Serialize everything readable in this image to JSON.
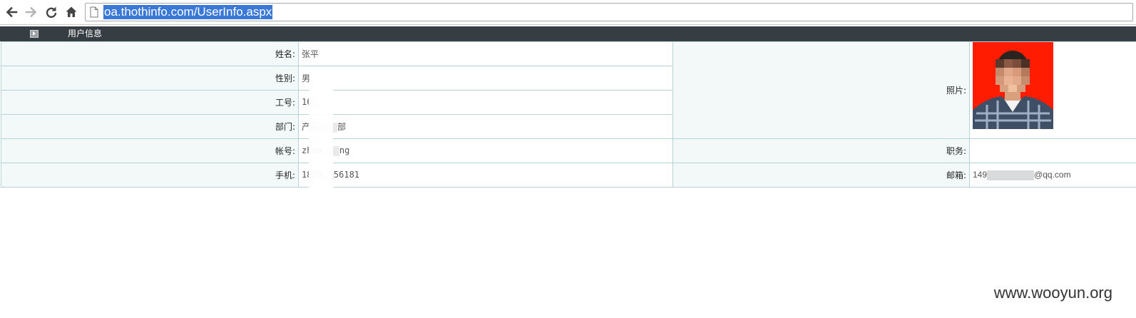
{
  "browser": {
    "url": "oa.thothinfo.com/UserInfo.aspx",
    "icons": [
      "back-icon",
      "forward-icon",
      "reload-icon",
      "home-icon",
      "page-icon"
    ]
  },
  "titlebar": {
    "title": "用户信息"
  },
  "fields": {
    "name": {
      "label": "姓名:",
      "value": "张平"
    },
    "gender": {
      "label": "性别:",
      "value": "男"
    },
    "emp_no": {
      "label": "工号:",
      "value": "16"
    },
    "dept": {
      "label": "部门:",
      "value_a": "产品",
      "value_b": "部"
    },
    "account": {
      "label": "帐号:",
      "value_a": "zhan",
      "value_b": "ng"
    },
    "mobile": {
      "label": "手机:",
      "value_a": "1826",
      "value_b": "56181"
    },
    "photo": {
      "label": "照片:"
    },
    "position": {
      "label": "职务:",
      "value": ""
    },
    "email": {
      "label": "邮箱:",
      "value_a": "149",
      "value_b": "@qq.com"
    }
  },
  "colors": {
    "titlebar": "#363d43",
    "label_bg": "#f3f9f9",
    "border": "#b8d3d7",
    "url_highlight": "#3a78d8",
    "photo_bg": "#ff1c00"
  },
  "watermark": "www.wooyun.org"
}
